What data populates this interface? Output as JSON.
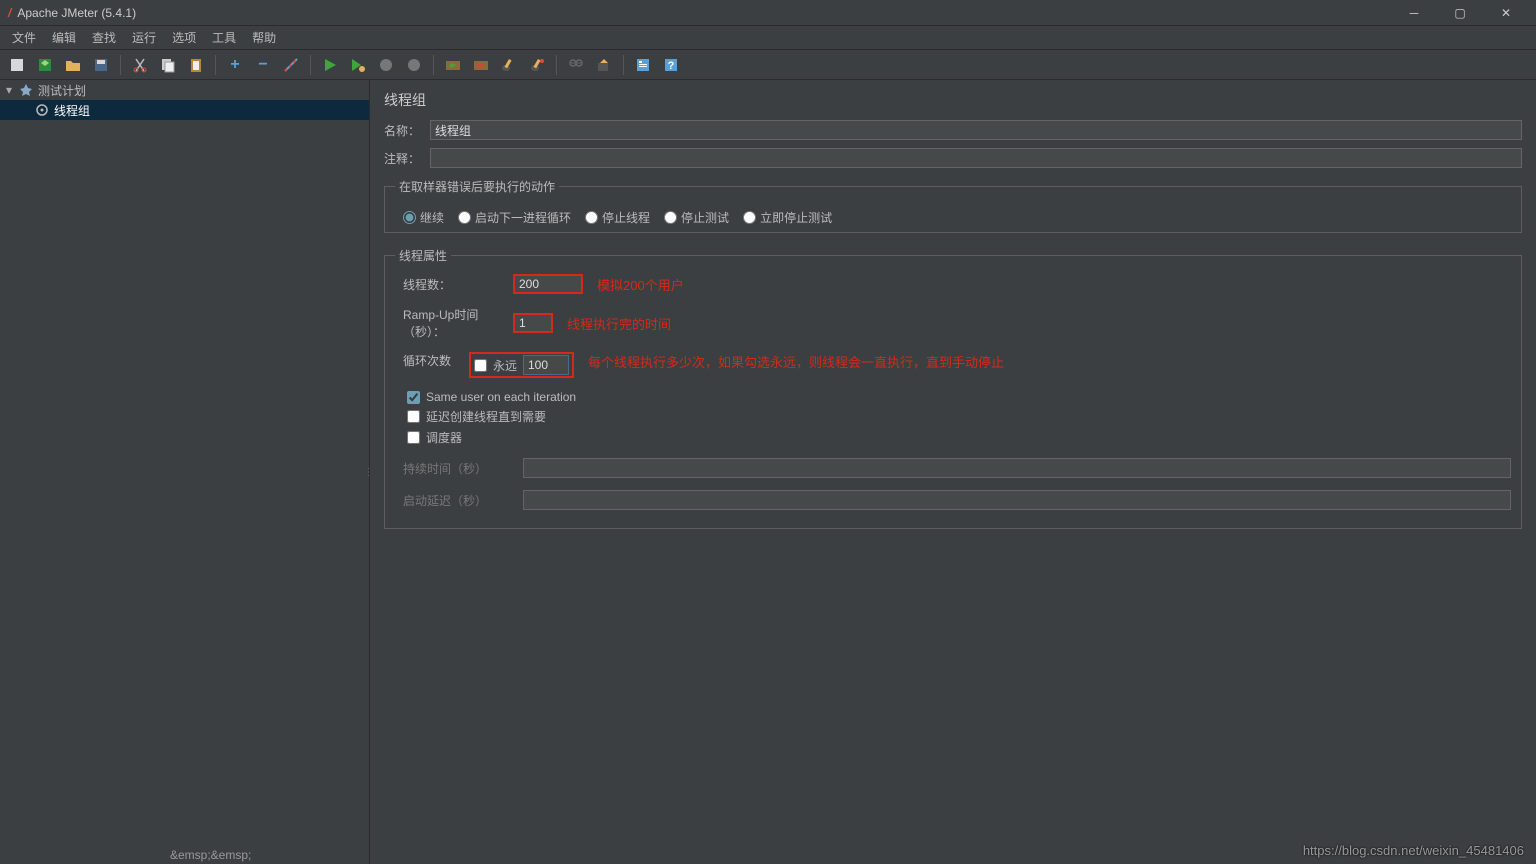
{
  "title": "Apache JMeter (5.4.1)",
  "menu": {
    "file": "文件",
    "edit": "编辑",
    "search": "查找",
    "run": "运行",
    "options": "选项",
    "tools": "工具",
    "help": "帮助"
  },
  "tree": {
    "root": "测试计划",
    "child": "线程组"
  },
  "panel": {
    "title": "线程组",
    "nameLabel": "名称：",
    "nameValue": "线程组",
    "commentsLabel": "注释：",
    "commentsValue": ""
  },
  "errorAction": {
    "legend": "在取样器错误后要执行的动作",
    "continue": "继续",
    "startNext": "启动下一进程循环",
    "stopThread": "停止线程",
    "stopTest": "停止测试",
    "stopNow": "立即停止测试"
  },
  "props": {
    "legend": "线程属性",
    "threadsLabel": "线程数：",
    "threadsValue": "200",
    "rampLabel": "Ramp-Up时间（秒）：",
    "rampValue": "1",
    "loopLabel": "循环次数",
    "forever": "永远",
    "loopValue": "100",
    "sameUser": "Same user on each iteration",
    "delayCreate": "延迟创建线程直到需要",
    "scheduler": "调度器",
    "durationLabel": "持续时间（秒）",
    "durationValue": "",
    "delayLabel": "启动延迟（秒）",
    "delayValue": ""
  },
  "annotations": {
    "threads": "模拟200个用户",
    "ramp": "线程执行完的时间",
    "loop": "每个线程执行多少次，如果勾选永远，则线程会一直执行，直到手动停止"
  },
  "watermark": "https://blog.csdn.net/weixin_45481406",
  "stub": "&emsp;&emsp;"
}
